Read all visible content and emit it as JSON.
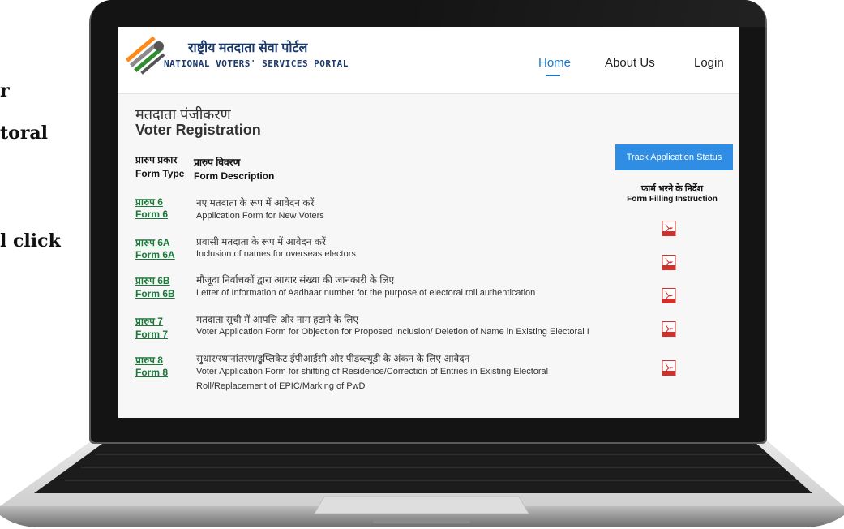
{
  "side_text": [
    "r",
    "toral",
    "l click"
  ],
  "portal": {
    "name_hi": "राष्ट्रीय मतदाता सेवा पोर्टल",
    "name_en": "NATIONAL VOTERS' SERVICES PORTAL"
  },
  "nav": {
    "home": "Home",
    "about": "About Us",
    "login": "Login"
  },
  "page": {
    "title_hi": "मतदाता पंजीकरण",
    "title_en": "Voter Registration"
  },
  "table_headers": {
    "type_hi": "प्रारुप प्रकार",
    "type_en": "Form Type",
    "desc_hi": "प्रारुप विवरण",
    "desc_en": "Form Description"
  },
  "track_button": "Track Application Status",
  "instructions": {
    "hi": "फार्म भरने के निर्देश",
    "en": "Form Filling Instruction"
  },
  "forms": [
    {
      "link_hi": "प्रारुप 6",
      "link_en": "Form 6",
      "desc_hi": "नए मतदाता के रूप में आवेदन करें",
      "desc_en": "Application Form for New Voters"
    },
    {
      "link_hi": "प्रारुप 6A",
      "link_en": "Form 6A",
      "desc_hi": "प्रवासी मतदाता के रूप में आवेदन करें",
      "desc_en": "Inclusion of names for overseas electors"
    },
    {
      "link_hi": "प्रारुप 6B",
      "link_en": "Form 6B",
      "desc_hi": "मौजूदा निर्वाचकों द्वारा आधार संख्या की जानकारी के लिए",
      "desc_en": "Letter of Information of Aadhaar number for the purpose of electoral roll authentication"
    },
    {
      "link_hi": "प्रारुप 7",
      "link_en": "Form 7",
      "desc_hi": "मतदाता सूची में आपत्ति और नाम हटाने के लिए",
      "desc_en": "Voter Application Form for Objection for Proposed Inclusion/ Deletion of Name in Existing Electoral I"
    },
    {
      "link_hi": "प्रारुप 8",
      "link_en": "Form 8",
      "desc_hi": "सुधार/स्थानांतरण/डुप्लिकेट ईपीआईसी और पीडब्ल्यूडी के अंकन के लिए आवेदन",
      "desc_en": "Voter Application Form for shifting of Residence/Correction of Entries in Existing Electoral",
      "desc_en_2": "Roll/Replacement of EPIC/Marking of PwD"
    }
  ],
  "icons": {
    "pdf": "pdf-icon",
    "logo": "eci-logo"
  },
  "colors": {
    "accent": "#1877c8",
    "button": "#2f8ee4",
    "link": "#1a7a3a",
    "pdf": "#d0312d"
  }
}
